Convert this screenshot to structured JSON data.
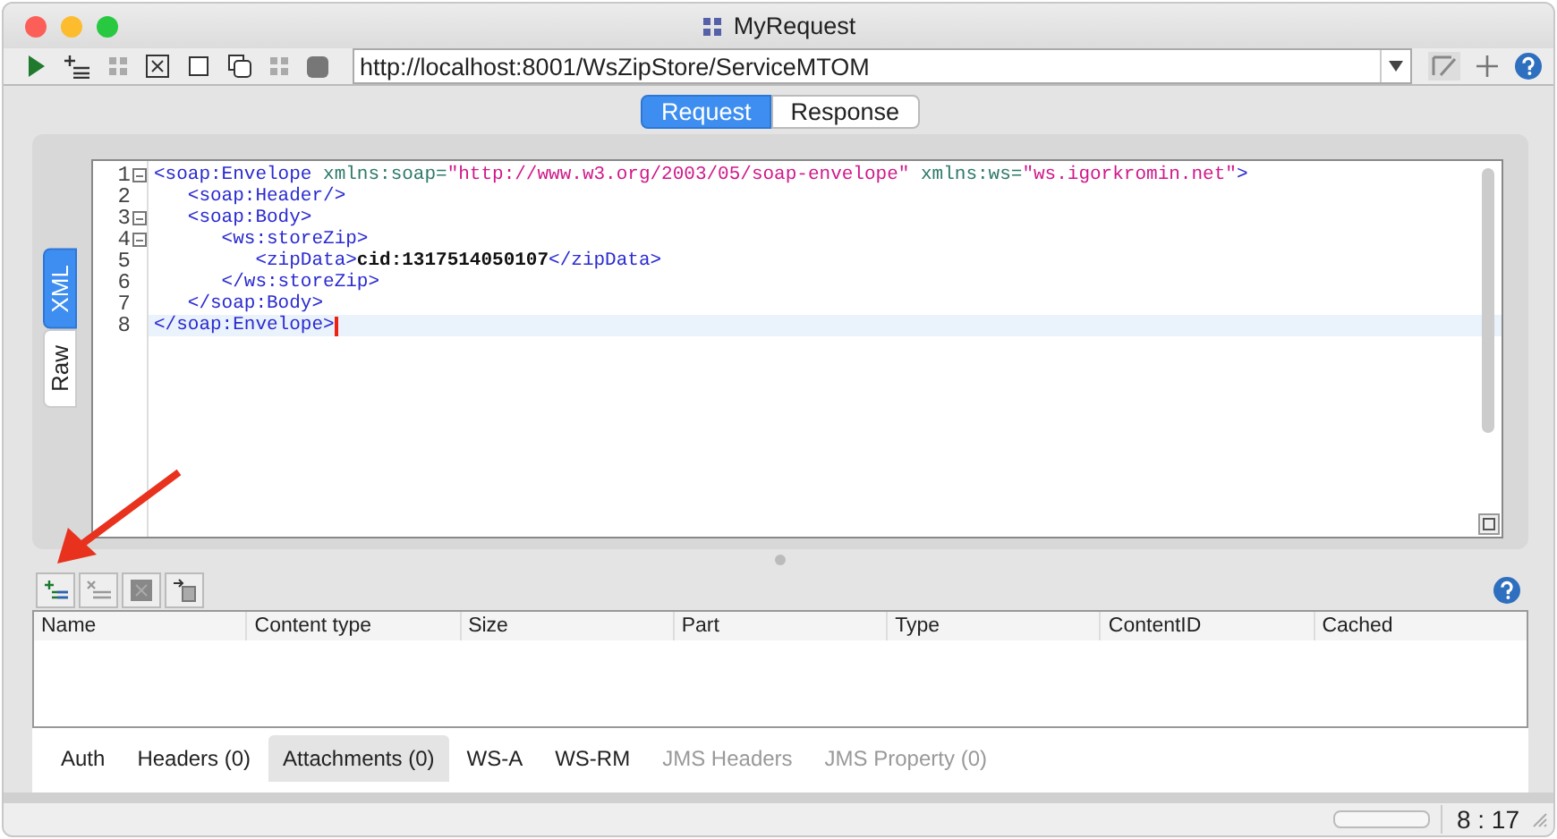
{
  "window": {
    "title": "MyRequest"
  },
  "toolbar": {
    "url": "http://localhost:8001/WsZipStore/ServiceMTOM"
  },
  "message_tabs": [
    {
      "label": "Request",
      "selected": true
    },
    {
      "label": "Response",
      "selected": false
    }
  ],
  "editor_tabs": [
    {
      "label": "XML",
      "selected": true
    },
    {
      "label": "Raw",
      "selected": false
    }
  ],
  "editor": {
    "lines": [
      {
        "number": "1",
        "foldable": true,
        "current": false,
        "segments": [
          {
            "kind": "tag",
            "text": "<soap:Envelope "
          },
          {
            "kind": "attr",
            "text": "xmlns:soap="
          },
          {
            "kind": "value",
            "text": "\"http://www.w3.org/2003/05/soap-envelope\" "
          },
          {
            "kind": "attr",
            "text": "xmlns:ws="
          },
          {
            "kind": "value",
            "text": "\"ws.igorkromin.net\""
          },
          {
            "kind": "tag",
            "text": ">"
          }
        ]
      },
      {
        "number": "2",
        "foldable": false,
        "current": false,
        "segments": [
          {
            "kind": "tag",
            "text": "   <soap:Header/>"
          }
        ]
      },
      {
        "number": "3",
        "foldable": true,
        "current": false,
        "segments": [
          {
            "kind": "tag",
            "text": "   <soap:Body>"
          }
        ]
      },
      {
        "number": "4",
        "foldable": true,
        "current": false,
        "segments": [
          {
            "kind": "tag",
            "text": "      <ws:storeZip>"
          }
        ]
      },
      {
        "number": "5",
        "foldable": false,
        "current": false,
        "segments": [
          {
            "kind": "tag",
            "text": "         <zipData>"
          },
          {
            "kind": "text",
            "text": "cid:1317514050107"
          },
          {
            "kind": "tag",
            "text": "</zipData>"
          }
        ]
      },
      {
        "number": "6",
        "foldable": false,
        "current": false,
        "segments": [
          {
            "kind": "tag",
            "text": "      </ws:storeZip>"
          }
        ]
      },
      {
        "number": "7",
        "foldable": false,
        "current": false,
        "segments": [
          {
            "kind": "tag",
            "text": "   </soap:Body>"
          }
        ]
      },
      {
        "number": "8",
        "foldable": false,
        "current": true,
        "segments": [
          {
            "kind": "tag",
            "text": "</soap:Envelope>"
          }
        ]
      }
    ]
  },
  "attachments": {
    "columns": [
      "Name",
      "Content type",
      "Size",
      "Part",
      "Type",
      "ContentID",
      "Cached"
    ]
  },
  "bottom_tabs": [
    {
      "label": "Auth",
      "selected": false,
      "disabled": false
    },
    {
      "label": "Headers (0)",
      "selected": false,
      "disabled": false
    },
    {
      "label": "Attachments (0)",
      "selected": true,
      "disabled": false
    },
    {
      "label": "WS-A",
      "selected": false,
      "disabled": false
    },
    {
      "label": "WS-RM",
      "selected": false,
      "disabled": false
    },
    {
      "label": "JMS Headers",
      "selected": false,
      "disabled": true
    },
    {
      "label": "JMS Property (0)",
      "selected": false,
      "disabled": true
    }
  ],
  "status_bar": {
    "position": "8 : 17"
  }
}
